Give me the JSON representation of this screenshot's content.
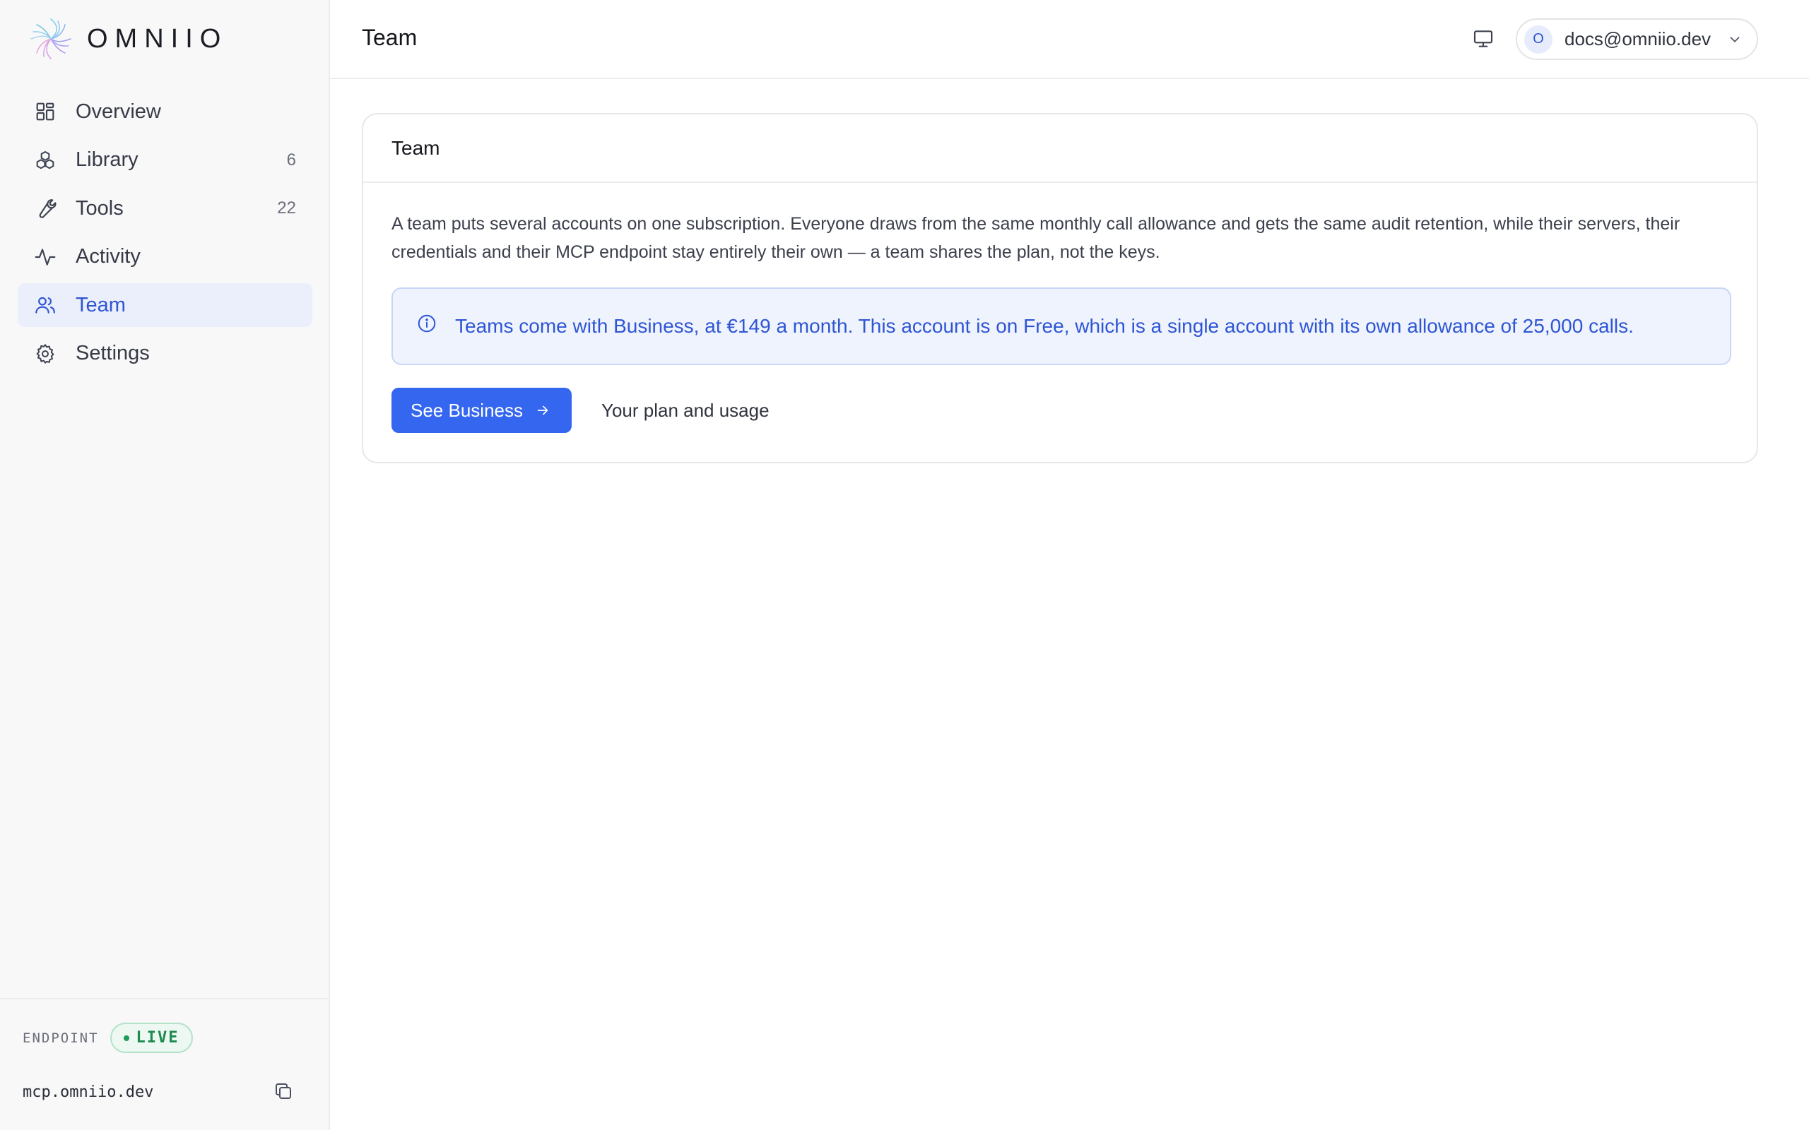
{
  "brand": {
    "name": "OMNIIO"
  },
  "sidebar": {
    "items": [
      {
        "label": "Overview",
        "icon": "grid-icon",
        "count": ""
      },
      {
        "label": "Library",
        "icon": "cubes-icon",
        "count": "6"
      },
      {
        "label": "Tools",
        "icon": "wrench-icon",
        "count": "22"
      },
      {
        "label": "Activity",
        "icon": "pulse-icon",
        "count": ""
      },
      {
        "label": "Team",
        "icon": "users-icon",
        "count": "",
        "active": true
      },
      {
        "label": "Settings",
        "icon": "gear-icon",
        "count": ""
      }
    ],
    "footer": {
      "endpoint_label": "ENDPOINT",
      "status": "LIVE",
      "url": "mcp.omniio.dev"
    }
  },
  "header": {
    "title": "Team",
    "user": {
      "initial": "O",
      "email": "docs@omniio.dev"
    }
  },
  "card": {
    "title": "Team",
    "description": "A team puts several accounts on one subscription. Everyone draws from the same monthly call allowance and gets the same audit retention, while their servers, their credentials and their MCP endpoint stay entirely their own — a team shares the plan, not the keys.",
    "notice": "Teams come with Business, at €149 a month. This account is on Free, which is a single account with its own allowance of 25,000 calls.",
    "primary_action": "See Business",
    "secondary_action": "Your plan and usage"
  },
  "colors": {
    "accent": "#3466f0",
    "active_nav_bg": "#eaeffb",
    "live_green": "#1d8a4f",
    "notice_bg": "#eef3fd"
  }
}
